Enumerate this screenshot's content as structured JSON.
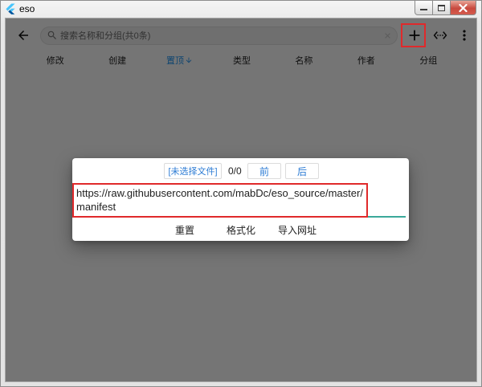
{
  "window": {
    "title": "eso",
    "app_icon": "flutter-logo-icon",
    "minimize_icon": "minimize-icon",
    "maximize_icon": "maximize-icon",
    "close_icon": "close-icon"
  },
  "appbar": {
    "back_icon": "arrow-back-icon",
    "search": {
      "icon": "search-icon",
      "placeholder": "搜索名称和分组(共0条)",
      "clear_icon": "clear-icon"
    },
    "add_icon": "plus-icon",
    "toggle_icon": "code-icon",
    "more_icon": "more-vert-icon"
  },
  "columns": [
    {
      "label": "修改"
    },
    {
      "label": "创建"
    },
    {
      "label": "置顶",
      "active": true,
      "sort_icon": "arrow-downward-icon"
    },
    {
      "label": "类型"
    },
    {
      "label": "名称"
    },
    {
      "label": "作者"
    },
    {
      "label": "分组"
    }
  ],
  "dialog": {
    "file_button": "[未选择文件]",
    "match_count": "0/0",
    "prev_button": "前",
    "next_button": "后",
    "url_input": {
      "value": "https://raw.githubusercontent.com/mabDc/eso_source/master/manifest"
    },
    "actions": {
      "reset": "重置",
      "format": "格式化",
      "import_url": "导入网址"
    }
  },
  "colors": {
    "active_column": "#2196f3",
    "dialog_button_text": "#2b7bd4",
    "input_underline": "#3aa99a",
    "highlight": "#e0292b",
    "close_button": "#c8493e"
  }
}
